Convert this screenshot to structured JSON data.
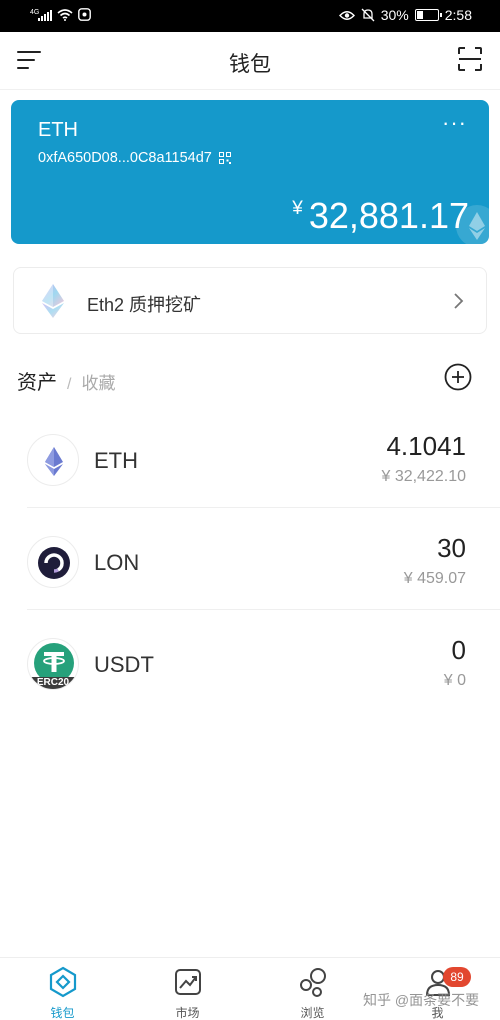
{
  "status_bar": {
    "network": "4G",
    "battery": "30%",
    "battery_level": 0.3,
    "time": "2:58"
  },
  "header": {
    "title": "钱包"
  },
  "wallet_card": {
    "name": "ETH",
    "address": "0xfA650D08...0C8a1154d7",
    "currency_symbol": "¥",
    "balance": "32,881.17",
    "more_label": "···",
    "color": "#1599cb"
  },
  "eth2_banner": {
    "label": "Eth2 质押挖矿"
  },
  "asset_tabs": {
    "active": "资产",
    "separator": "/",
    "inactive": "收藏"
  },
  "tokens": [
    {
      "symbol": "ETH",
      "amount": "4.1041",
      "value": "¥ 32,422.10",
      "icon": "eth-icon"
    },
    {
      "symbol": "LON",
      "amount": "30",
      "value": "¥ 459.07",
      "icon": "lon-icon"
    },
    {
      "symbol": "USDT",
      "amount": "0",
      "value": "¥ 0",
      "icon": "usdt-erc20-icon",
      "icon_text": "ERC20"
    }
  ],
  "bottom_nav": {
    "items": [
      {
        "label": "钱包",
        "icon": "wallet-icon",
        "active": true
      },
      {
        "label": "市场",
        "icon": "market-chart-icon"
      },
      {
        "label": "浏览",
        "icon": "browse-bubbles-icon"
      },
      {
        "label": "我",
        "icon": "profile-icon",
        "badge": "89"
      }
    ],
    "accent": "#1599cb",
    "badge_color": "#e2472f"
  },
  "watermark": "知乎 @面条要不要"
}
